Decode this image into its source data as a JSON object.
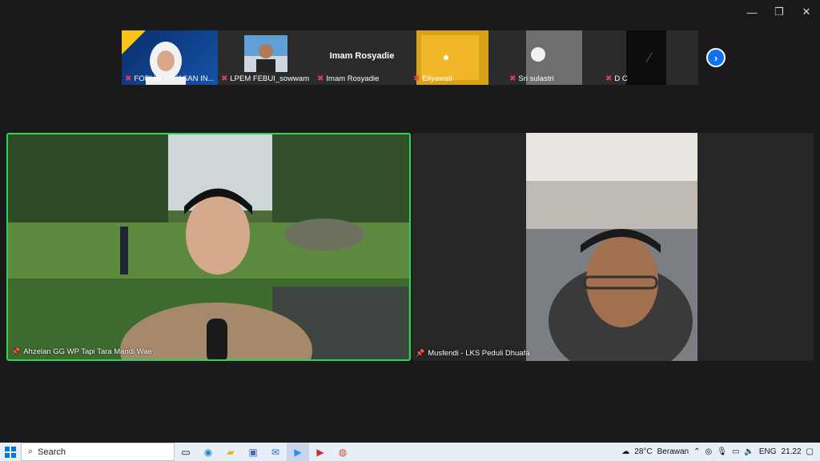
{
  "window_controls": {
    "minimize": "—",
    "restore": "❐",
    "close": "✕"
  },
  "filmstrip": {
    "tiles": [
      {
        "label": "FORUM YAYASAN IN...",
        "muted": true
      },
      {
        "label": "LPEM FEBUI_sowwam",
        "muted": true
      },
      {
        "label": "Imam Rosyadie",
        "big_name": "Imam Rosyadie",
        "muted": true
      },
      {
        "label": "Eliyawati",
        "muted": true
      },
      {
        "label": "Sri sulastri",
        "muted": true
      },
      {
        "label": "D C",
        "muted": true
      }
    ],
    "next_icon": "›"
  },
  "main": {
    "left_label": "Ahzelan GG WP Tapi Tara Mandi Wae",
    "right_label": "Musfendi - LKS Peduli Dhuafa"
  },
  "taskbar": {
    "search_label": "Search",
    "weather_temp": "28°C",
    "weather_text": "Berawan",
    "language": "ENG",
    "time": "21.22"
  },
  "colors": {
    "active_speaker": "#23d959",
    "accent": "#0e72ed",
    "muted_mic": "#e0424b"
  }
}
